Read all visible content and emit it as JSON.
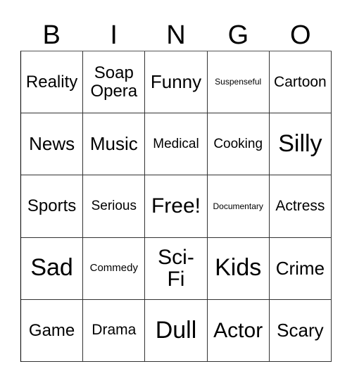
{
  "header": {
    "letters": [
      "B",
      "I",
      "N",
      "G",
      "O"
    ]
  },
  "grid": {
    "cells": [
      "Reality",
      "Soap Opera",
      "Funny",
      "Suspenseful",
      "Cartoon",
      "News",
      "Music",
      "Medical",
      "Cooking",
      "Silly",
      "Sports",
      "Serious",
      "Free!",
      "Documentary",
      "Actress",
      "Sad",
      "Commedy",
      "Sci-Fi",
      "Kids",
      "Crime",
      "Game",
      "Drama",
      "Dull",
      "Actor",
      "Scary"
    ]
  }
}
